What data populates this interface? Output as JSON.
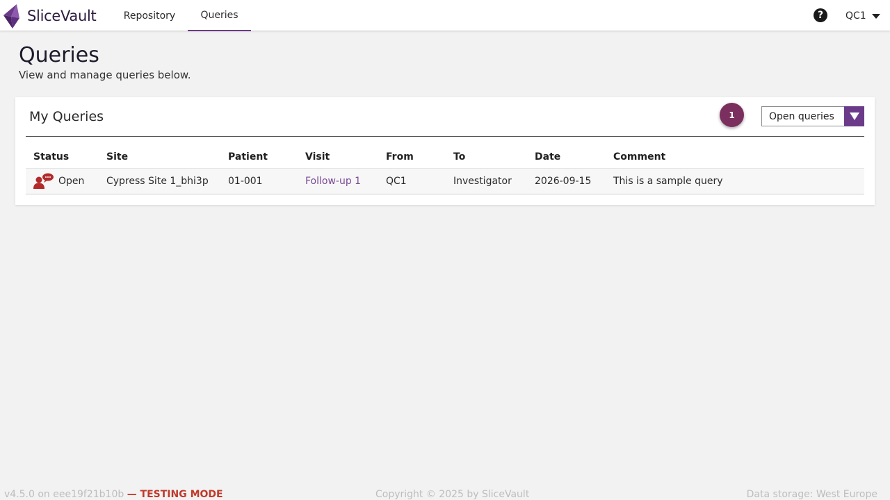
{
  "app": {
    "brand_name": "SliceVault",
    "brand_color": "#6b3b8a"
  },
  "nav": {
    "items": [
      {
        "label": "Repository",
        "active": false
      },
      {
        "label": "Queries",
        "active": true
      }
    ],
    "help_icon": "question-circle-icon",
    "help_glyph": "?",
    "user": "QC1"
  },
  "page": {
    "title": "Queries",
    "subtitle": "View and manage queries below."
  },
  "card": {
    "title": "My Queries",
    "count": "1",
    "count_color": "#7b2f5e",
    "filter": {
      "selected": "Open queries"
    }
  },
  "table": {
    "headers": [
      "Status",
      "Site",
      "Patient",
      "Visit",
      "From",
      "To",
      "Date",
      "Comment"
    ],
    "rows": [
      {
        "status_icon": "open-query-icon",
        "status": "Open",
        "site": "Cypress Site 1_bhi3p",
        "patient": "01-001",
        "visit": "Follow-up 1",
        "from": "QC1",
        "to": "Investigator",
        "date": "2026-09-15",
        "comment": "This is a sample query"
      }
    ]
  },
  "footer": {
    "version": "v4.5.0 on eee19f21b10b",
    "testing": "— TESTING MODE",
    "copyright": "Copyright © 2025 by SliceVault",
    "storage": "Data storage: West Europe"
  }
}
